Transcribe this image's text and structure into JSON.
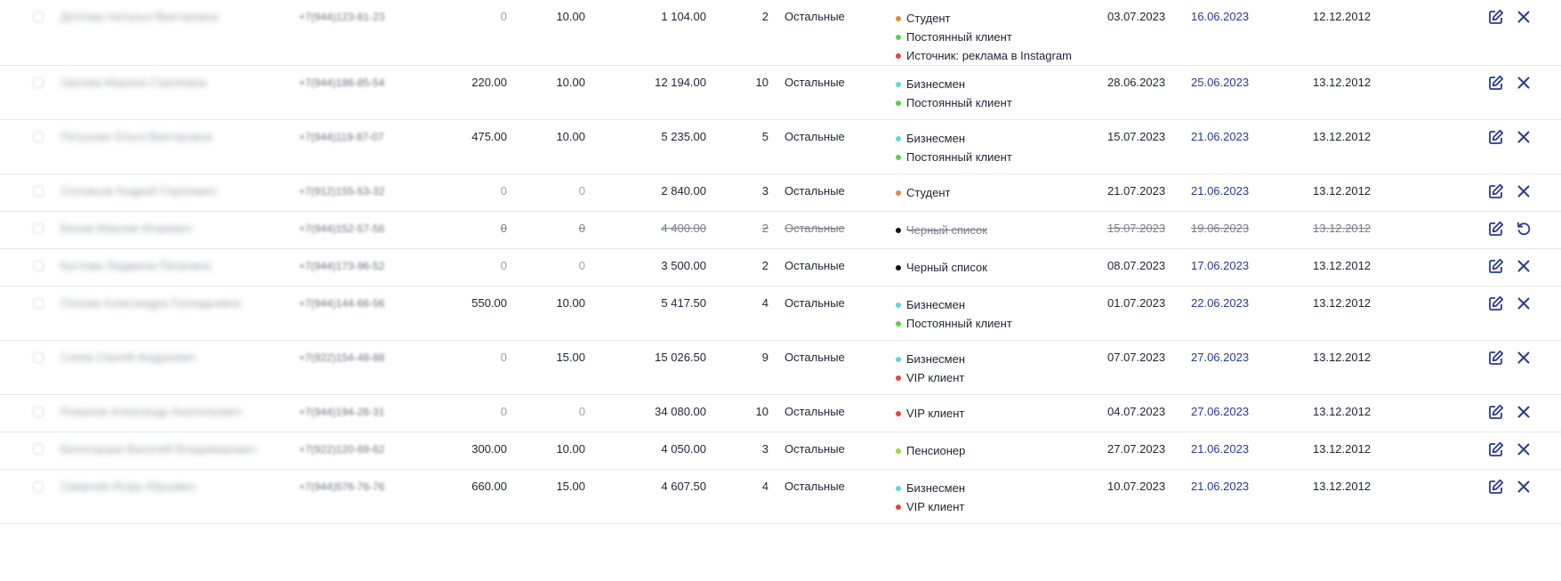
{
  "colors": {
    "student": "#e8893a",
    "regular": "#58d14a",
    "instagram": "#e8443a",
    "businessman": "#5fd6d8",
    "blacklist": "#111111",
    "vip": "#e8443a",
    "pensioner": "#9ad83a",
    "link_date": "#2b3a8c",
    "icon": "#2b3a8c"
  },
  "rows": [
    {
      "name": "Долгова Наталья Викторовна",
      "phone": "+7(944)123-81-23",
      "bonus": "0",
      "discount": "10.00",
      "sum": "1 104.00",
      "count": "2",
      "group": "Остальные",
      "tags": [
        {
          "label": "Студент",
          "color": "#e8893a"
        },
        {
          "label": "Постоянный клиент",
          "color": "#58d14a"
        },
        {
          "label": "Источник: реклама в Instagram",
          "color": "#e8443a"
        }
      ],
      "date1": "03.07.2023",
      "date2": "16.06.2023",
      "date3": "12.12.2012",
      "deleted": false,
      "height": 74
    },
    {
      "name": "Орлова Марина Сергеевна",
      "phone": "+7(944)186-85-54",
      "bonus": "220.00",
      "discount": "10.00",
      "sum": "12 194.00",
      "count": "10",
      "group": "Остальные",
      "tags": [
        {
          "label": "Бизнесмен",
          "color": "#5fd6d8"
        },
        {
          "label": "Постоянный клиент",
          "color": "#58d14a"
        }
      ],
      "date1": "28.06.2023",
      "date2": "25.06.2023",
      "date3": "13.12.2012",
      "deleted": false,
      "height": 61
    },
    {
      "name": "Петухова Ольга Викторовна",
      "phone": "+7(944)119-87-07",
      "bonus": "475.00",
      "discount": "10.00",
      "sum": "5 235.00",
      "count": "5",
      "group": "Остальные",
      "tags": [
        {
          "label": "Бизнесмен",
          "color": "#5fd6d8"
        },
        {
          "label": "Постоянный клиент",
          "color": "#58d14a"
        }
      ],
      "date1": "15.07.2023",
      "date2": "21.06.2023",
      "date3": "13.12.2012",
      "deleted": false,
      "height": 61
    },
    {
      "name": "Соловьев Андрей Сергеевич",
      "phone": "+7(912)155-53-32",
      "bonus": "0",
      "discount": "0",
      "sum": "2 840.00",
      "count": "3",
      "group": "Остальные",
      "tags": [
        {
          "label": "Студент",
          "color": "#e8893a"
        }
      ],
      "date1": "21.07.2023",
      "date2": "21.06.2023",
      "date3": "13.12.2012",
      "deleted": false,
      "height": 42
    },
    {
      "name": "Белов Максим Игоревич",
      "phone": "+7(944)152-57-56",
      "bonus": "0",
      "discount": "0",
      "sum": "4 400.00",
      "count": "2",
      "group": "Остальные",
      "tags": [
        {
          "label": "Черный список",
          "color": "#111111"
        }
      ],
      "date1": "15.07.2023",
      "date2": "19.06.2023",
      "date3": "13.12.2012",
      "deleted": true,
      "height": 42
    },
    {
      "name": "Кустова Людмила Петровна",
      "phone": "+7(944)173-96-52",
      "bonus": "0",
      "discount": "0",
      "sum": "3 500.00",
      "count": "2",
      "group": "Остальные",
      "tags": [
        {
          "label": "Черный список",
          "color": "#111111"
        }
      ],
      "date1": "08.07.2023",
      "date2": "17.06.2023",
      "date3": "13.12.2012",
      "deleted": false,
      "height": 42
    },
    {
      "name": "Попова Александра Геннадьевна",
      "phone": "+7(944)144-66-56",
      "bonus": "550.00",
      "discount": "10.00",
      "sum": "5 417.50",
      "count": "4",
      "group": "Остальные",
      "tags": [
        {
          "label": "Бизнесмен",
          "color": "#5fd6d8"
        },
        {
          "label": "Постоянный клиент",
          "color": "#58d14a"
        }
      ],
      "date1": "01.07.2023",
      "date2": "22.06.2023",
      "date3": "13.12.2012",
      "deleted": false,
      "height": 61
    },
    {
      "name": "Сизов Сергей Андреевич",
      "phone": "+7(922)154-48-88",
      "bonus": "0",
      "discount": "15.00",
      "sum": "15 026.50",
      "count": "9",
      "group": "Остальные",
      "tags": [
        {
          "label": "Бизнесмен",
          "color": "#5fd6d8"
        },
        {
          "label": "VIP клиент",
          "color": "#e8443a"
        }
      ],
      "date1": "07.07.2023",
      "date2": "27.06.2023",
      "date3": "13.12.2012",
      "deleted": false,
      "height": 61
    },
    {
      "name": "Романов Александр Анатольевич",
      "phone": "+7(944)194-26-31",
      "bonus": "0",
      "discount": "0",
      "sum": "34 080.00",
      "count": "10",
      "group": "Остальные",
      "tags": [
        {
          "label": "VIP клиент",
          "color": "#e8443a"
        }
      ],
      "date1": "04.07.2023",
      "date2": "27.06.2023",
      "date3": "13.12.2012",
      "deleted": false,
      "height": 42
    },
    {
      "name": "Белогорцев Василий Владимирович",
      "phone": "+7(922)120-69-62",
      "bonus": "300.00",
      "discount": "10.00",
      "sum": "4 050.00",
      "count": "3",
      "group": "Остальные",
      "tags": [
        {
          "label": "Пенсионер",
          "color": "#9ad83a"
        }
      ],
      "date1": "27.07.2023",
      "date2": "21.06.2023",
      "date3": "13.12.2012",
      "deleted": false,
      "height": 42
    },
    {
      "name": "Смирнов Игорь Юрьевич",
      "phone": "+7(944)576-76-76",
      "bonus": "660.00",
      "discount": "15.00",
      "sum": "4 607.50",
      "count": "4",
      "group": "Остальные",
      "tags": [
        {
          "label": "Бизнесмен",
          "color": "#5fd6d8"
        },
        {
          "label": "VIP клиент",
          "color": "#e8443a"
        }
      ],
      "date1": "10.07.2023",
      "date2": "21.06.2023",
      "date3": "13.12.2012",
      "deleted": false,
      "height": 61
    }
  ]
}
